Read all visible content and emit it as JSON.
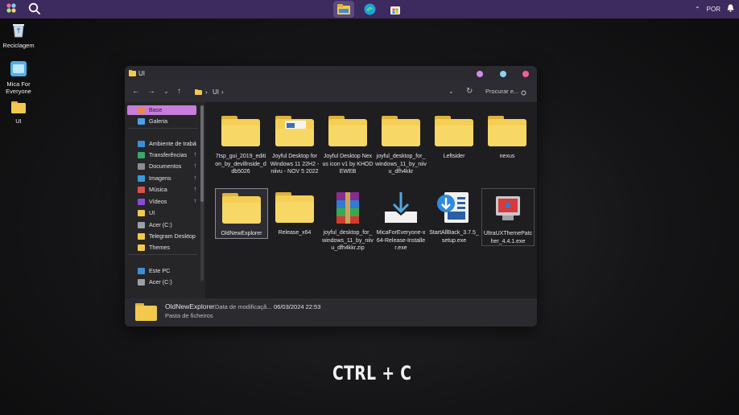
{
  "taskbar": {
    "apps": [
      "file-explorer",
      "edge",
      "store"
    ],
    "language": "POR"
  },
  "desktop": {
    "icons": [
      {
        "label": "Reciclagem",
        "icon": "recycle-bin-icon"
      },
      {
        "label": "Mica For Everyone",
        "icon": "app-icon"
      },
      {
        "label": "UI",
        "icon": "folder-icon"
      }
    ]
  },
  "window": {
    "title": "UI",
    "breadcrumb": "UI",
    "search_placeholder": "Procurar e..."
  },
  "sidebar": {
    "items": [
      {
        "label": "Base",
        "selected": true,
        "color": "#e98a4a"
      },
      {
        "label": "Galeria",
        "color": "#4aa3e9"
      },
      {
        "label": "Ambiente de trabalho",
        "color": "#3b8fd9",
        "pinned": true
      },
      {
        "label": "Transferências",
        "color": "#39a86b",
        "pinned": true
      },
      {
        "label": "Documentos",
        "color": "#8b8b95",
        "pinned": true
      },
      {
        "label": "Imagens",
        "color": "#3b9ad9",
        "pinned": true
      },
      {
        "label": "Música",
        "color": "#d9524a",
        "pinned": true
      },
      {
        "label": "Vídeos",
        "color": "#8a4ad9",
        "pinned": true
      },
      {
        "label": "UI",
        "color": "#f2c94c"
      },
      {
        "label": "Acer (C:)",
        "color": "#9aa0a8"
      },
      {
        "label": "Telegram Desktop",
        "color": "#f2c94c"
      },
      {
        "label": "Themes",
        "color": "#f2c94c"
      },
      {
        "label": "Este PC",
        "color": "#3b8fd9"
      },
      {
        "label": "Acer (C:)",
        "color": "#9aa0a8"
      }
    ]
  },
  "files": [
    {
      "name": "7tsp_gui_2019_edition_by_devillnside_ddb5026",
      "type": "folder"
    },
    {
      "name": "Joyful Desktop for Windows 11 22H2 - niivu - NOV 5 2022",
      "type": "folder-doc"
    },
    {
      "name": "Joyful Desktop Nexus icon v1 by KHODEWEB",
      "type": "folder"
    },
    {
      "name": "joyful_desktop_for_windows_11_by_niivu_dfh4kkr",
      "type": "folder"
    },
    {
      "name": "Leftsider",
      "type": "folder"
    },
    {
      "name": "nexus",
      "type": "folder"
    },
    {
      "name": "OldNewExplorer",
      "type": "folder",
      "selected": true
    },
    {
      "name": "Release_x64",
      "type": "folder"
    },
    {
      "name": "joyful_desktop_for_windows_11_by_niivu_dfh4kkr.zip",
      "type": "winrar"
    },
    {
      "name": "MicaForEveryone-x64-Release-Installer.exe",
      "type": "installer"
    },
    {
      "name": "StartAllBack_3.7.5_setup.exe",
      "type": "setup"
    },
    {
      "name": "UltraUXThemePatcher_4.4.1.exe",
      "type": "patcher"
    }
  ],
  "status": {
    "name": "OldNewExplorer",
    "kind": "Pasta de ficheiros",
    "date_label": "Data de modificaçã...",
    "date_value": "06/03/2024 22:53"
  },
  "overlay": {
    "text": "CTRL + C"
  },
  "colors": {
    "accent": "#c77ddc",
    "taskbar": "#3d2a5e",
    "folder": "#f2c94c"
  }
}
